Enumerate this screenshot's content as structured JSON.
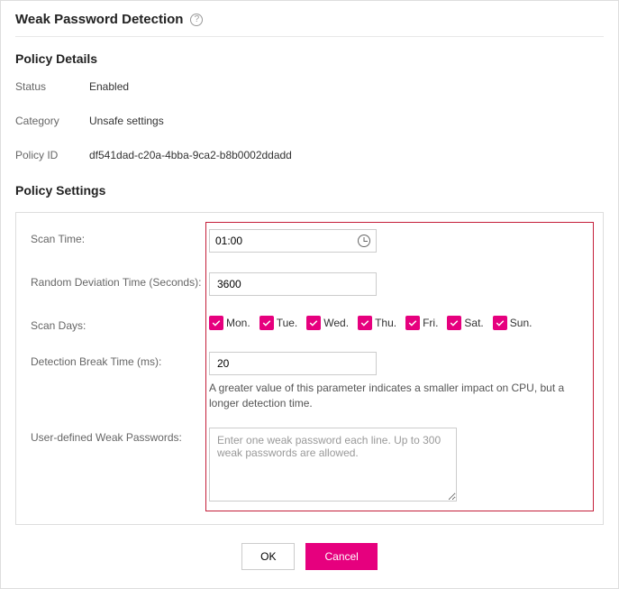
{
  "header": {
    "title": "Weak Password Detection"
  },
  "policyDetails": {
    "sectionTitle": "Policy Details",
    "statusLabel": "Status",
    "statusValue": "Enabled",
    "categoryLabel": "Category",
    "categoryValue": "Unsafe settings",
    "policyIdLabel": "Policy ID",
    "policyIdValue": "df541dad-c20a-4bba-9ca2-b8b0002ddadd"
  },
  "policySettings": {
    "sectionTitle": "Policy Settings",
    "scanTime": {
      "label": "Scan Time:",
      "value": "01:00"
    },
    "randomDeviation": {
      "label": "Random Deviation Time (Seconds):",
      "value": "3600"
    },
    "scanDays": {
      "label": "Scan Days:",
      "days": [
        "Mon.",
        "Tue.",
        "Wed.",
        "Thu.",
        "Fri.",
        "Sat.",
        "Sun."
      ]
    },
    "breakTime": {
      "label": "Detection Break Time (ms):",
      "value": "20",
      "hint": "A greater value of this parameter indicates a smaller impact on CPU, but a longer detection time."
    },
    "weakPasswords": {
      "label": "User-defined Weak Passwords:",
      "placeholder": "Enter one weak password each line. Up to 300 weak passwords are allowed."
    }
  },
  "buttons": {
    "ok": "OK",
    "cancel": "Cancel"
  }
}
